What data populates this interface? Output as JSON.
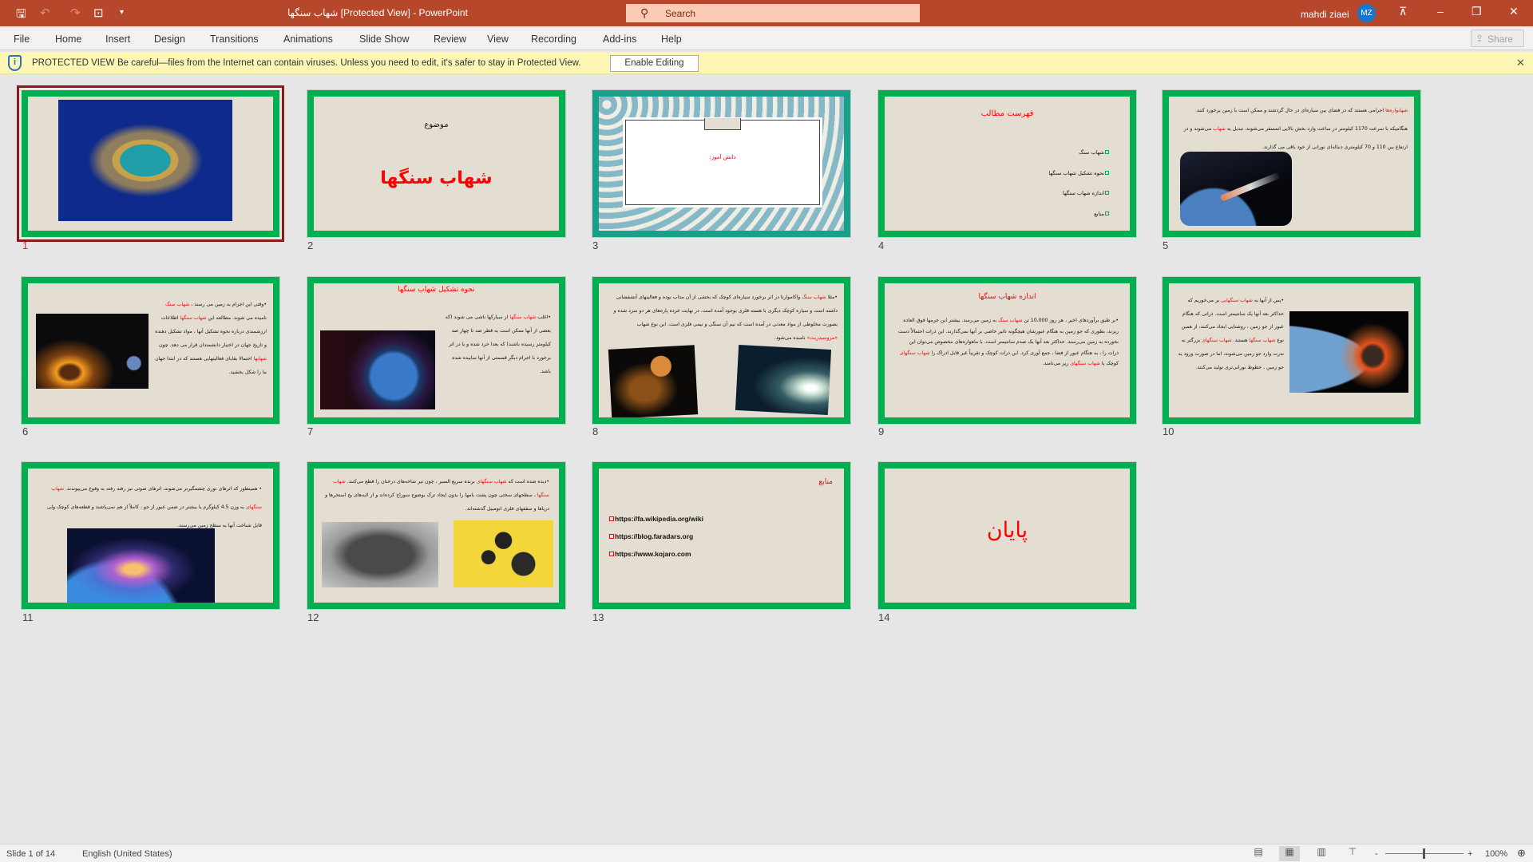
{
  "titlebar": {
    "title": "شهاب سنگها [Protected View]  -  PowerPoint",
    "search_placeholder": "Search",
    "user": "mahdi ziaei",
    "avatar_initials": "MZ",
    "accent": "#b7472a"
  },
  "menu": [
    "File",
    "Home",
    "Insert",
    "Design",
    "Transitions",
    "Animations",
    "Slide Show",
    "Review",
    "View",
    "Recording",
    "Add-ins",
    "Help"
  ],
  "share_label": "Share",
  "protected": {
    "label": "PROTECTED VIEW",
    "message": "Be careful—files from the Internet can contain viruses. Unless you need to edit, it's safer to stay in Protected View.",
    "button": "Enable Editing",
    "bg": "#fdf6b4"
  },
  "slides": {
    "s2": {
      "subtitle": "موضوع",
      "title": "شهاب سنگها"
    },
    "s3": {
      "label": "دانش آموز:"
    },
    "s4": {
      "title": "فهرست مطالب",
      "items": [
        "شهاب سنگ",
        "نحوه تشکیل شهاب سنگها",
        "اندازه شهاب سنگها",
        "منابع"
      ]
    },
    "s5": {
      "body": [
        {
          "t": "شهابواره‌ها",
          "r": true
        },
        {
          "t": " اجرامی هستند که در فضای بین سیاره‌ای در حال گردشند و ممکن است با زمین برخورد کنند. هنگامیکه با سرعت 1170 کیلومتر در ساعت وارد بخش بالایی اتمسفر می‌شوند، تبدیل به "
        },
        {
          "t": "شهاب",
          "r": true
        },
        {
          "t": " می‌شوند و در ارتفاع بین 110 و 70 کیلومتری دنباله‌ای نورانی از خود باقی می گذارند."
        }
      ]
    },
    "s6": {
      "body": [
        {
          "t": "•وقتی این اجرام به زمین می رسند ، "
        },
        {
          "t": "شهاب سنگ",
          "r": true
        },
        {
          "t": " نامیده می شوند. مطالعه این "
        },
        {
          "t": "شهاب سنگها",
          "r": true
        },
        {
          "t": " اطلاعات ارزشمندی درباره نحوه تشکیل آنها ، مواد تشکیل دهنده و تاریخ جهان در اختیار دانشمندان قرار می دهد. چون "
        },
        {
          "t": "شهابها",
          "r": true
        },
        {
          "t": " احتمالا بقایای فعالیتهایی هستند که در ابتدا جهان ما را شکل بخشید."
        }
      ]
    },
    "s7": {
      "title": "نحوه تشکیل شهاب سنگها",
      "body": [
        {
          "t": "•اغلب "
        },
        {
          "t": "شهاب سنگها",
          "r": true
        },
        {
          "t": " از سیارکها ناشی می شوند (که بعضی از آنها ممکن است به قطر صد تا چهار صد کیلومتر رسیده باشند) که بعدا خرد شده و یا در اثر برخورد با اجرام دیگر قسمتی از آنها ساییده شده باشد."
        }
      ]
    },
    "s8": {
      "body": [
        {
          "t": "•مثلا "
        },
        {
          "t": "شهاب سنگ",
          "r": true
        },
        {
          "t": " واکاموارتا در اثر برخورد سیاره‌ای کوچک که بخشی از آن مذاب بوده و فعالیتهای آتشفشانی داشته است و سیاره کوچک دیگری با هسته فلزی بوجود آمده است. در نهایت خرده پاره‌های هر دو سرد شده و بصورت مخلوطی از مواد معدنی در آمده است که نیم آن سنگی و نیمی فلزی است. این نوع شهاب "
        },
        {
          "t": "«مزوسیدریت»",
          "r": true
        },
        {
          "t": " نامیده می‌شود."
        }
      ]
    },
    "s9": {
      "title": "اندازه شهاب سنگها",
      "body": [
        {
          "t": "•بر طبق برآوردهای اخیر ، هر روز 10،000 تن "
        },
        {
          "t": "شهاب سنگ",
          "r": true
        },
        {
          "t": " به زمین می‌رسد. بیشتر این جرمها فوق العاده ریزند، بطوری که جو زمین به هنگام عبورشان هیچگونه تاثیر خاصی بر آنها نمی‌گذارند. این ذرات احتمالاً دست نخورده به زمین می‌رسند. حداکثر بعد آنها یک صدم سانتیمتر است. با ماهواره‌های مخصوص می‌توان این ذرات را ، به هنگام عبور از فضا ، جمع آوری کرد. این ذرات کوچک و تقریباً غیر قابل ادراک را "
        },
        {
          "t": "شهاب سنگهای",
          "r": true
        },
        {
          "t": " کوچک یا "
        },
        {
          "t": "شهاب سنگهای",
          "r": true
        },
        {
          "t": " ریز می‌نامند."
        }
      ]
    },
    "s10": {
      "body": [
        {
          "t": "•پس از آنها به "
        },
        {
          "t": "شهاب سنگهایی",
          "r": true
        },
        {
          "t": " بر می‌خوریم که حداکثر بعد آنها یک سانتیمتر است. ذراتی که هنگام عبور از جو زمین ، روشنایی ایجاد می‌کنند، از همین نوع "
        },
        {
          "t": "شهاب سنگها",
          "r": true
        },
        {
          "t": " هستند. "
        },
        {
          "t": "شهاب سنگهای",
          "r": true
        },
        {
          "t": " بزرگتر به ندرت وارد جو زمین می‌شوند، اما در صورت ورود به جو زمین ، خطوط نورانی‌تری تولید می‌کنند."
        }
      ]
    },
    "s11": {
      "body": [
        {
          "t": "• همینطور که اثرهای نوری چشمگیرتر می‌شوند، اثرهای صوتی نیز رفته رفته به وقوع می‌پیوندند. "
        },
        {
          "t": "شهاب سنگهای",
          "r": true
        },
        {
          "t": " به وزن 4.5 کیلوگرم یا بیشتر در ضمن عبور از جو ، کاملاً از هم نمی‌پاشند و قطعه‌های کوچک ولی قابل شناخت آنها به سطح زمین می‌رسند."
        }
      ]
    },
    "s12": {
      "body": [
        {
          "t": "•دیده شده است که "
        },
        {
          "t": "شهاب سنگهای",
          "r": true
        },
        {
          "t": " برنده سریع السیر ، چون تیر شاخه‌های درختان را قطع می‌کنند. "
        },
        {
          "t": "شهاب سنگها",
          "r": true
        },
        {
          "t": " ، سطحهای سختی چون پشت بامها را بدون ایجاد ترک بوضوح سوراخ کرده‌اند و از لایه‌های یخ استخرها و دریاها و سقفهای فلزی اتومبیل گذشته‌اند."
        }
      ]
    },
    "s13": {
      "title": "منابع",
      "links": [
        "https://fa.wikipedia.org/wiki",
        "https://blog.faradars.org",
        "https://www.kojaro.com"
      ]
    },
    "s14": {
      "title": "پایان"
    },
    "numbers": [
      "1",
      "2",
      "3",
      "4",
      "5",
      "6",
      "7",
      "8",
      "9",
      "10",
      "11",
      "12",
      "13",
      "14"
    ],
    "border_color": "#00b050"
  },
  "status": {
    "slide": "Slide 1 of 14",
    "language": "English (United States)",
    "zoom": "100%",
    "zoom_minus": "-",
    "zoom_plus": "+"
  }
}
